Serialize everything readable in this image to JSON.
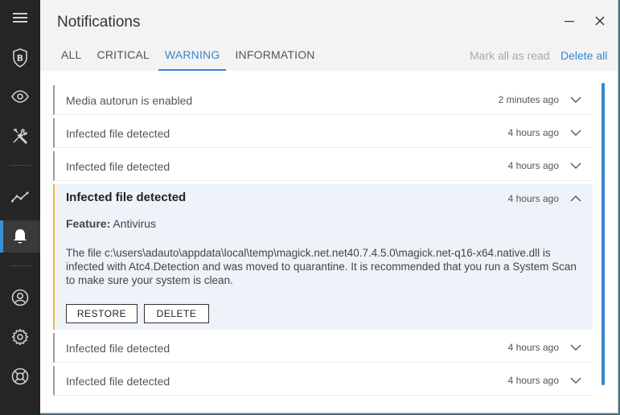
{
  "window": {
    "title": "Notifications",
    "tabs": [
      {
        "label": "ALL",
        "active": false
      },
      {
        "label": "CRITICAL",
        "active": false
      },
      {
        "label": "WARNING",
        "active": true
      },
      {
        "label": "INFORMATION",
        "active": false
      }
    ],
    "mark_all_read": "Mark all as read",
    "delete_all": "Delete all"
  },
  "sidebar": {
    "items": [
      {
        "icon": "menu-icon"
      },
      {
        "icon": "bitdefender-logo-icon",
        "letter": "B"
      },
      {
        "icon": "eye-icon"
      },
      {
        "icon": "tools-icon"
      },
      {
        "icon": "activity-icon"
      },
      {
        "icon": "bell-icon",
        "active": true
      },
      {
        "icon": "user-icon"
      },
      {
        "icon": "gear-icon"
      },
      {
        "icon": "lifebuoy-icon"
      }
    ]
  },
  "notifications": [
    {
      "title": "Media autorun is enabled",
      "time": "2 minutes ago"
    },
    {
      "title": "Infected file detected",
      "time": "4 hours ago"
    },
    {
      "title": "Infected file detected",
      "time": "4 hours ago"
    }
  ],
  "expanded": {
    "title": "Infected file detected",
    "time": "4 hours ago",
    "feature_label": "Feature:",
    "feature_value": "Antivirus",
    "body": "The file c:\\users\\adauto\\appdata\\local\\temp\\magick.net.net40.7.4.5.0\\magick.net-q16-x64.native.dll is infected with Atc4.Detection and was moved to quarantine. It is recommended that you run a System Scan to make sure your system is clean.",
    "restore_label": "RESTORE",
    "delete_label": "DELETE"
  },
  "notifications_after": [
    {
      "title": "Infected file detected",
      "time": "4 hours ago"
    },
    {
      "title": "Infected file detected",
      "time": "4 hours ago"
    }
  ],
  "colors": {
    "accent": "#3a86cf",
    "warning": "#f0b43c",
    "sidebar": "#252526"
  }
}
